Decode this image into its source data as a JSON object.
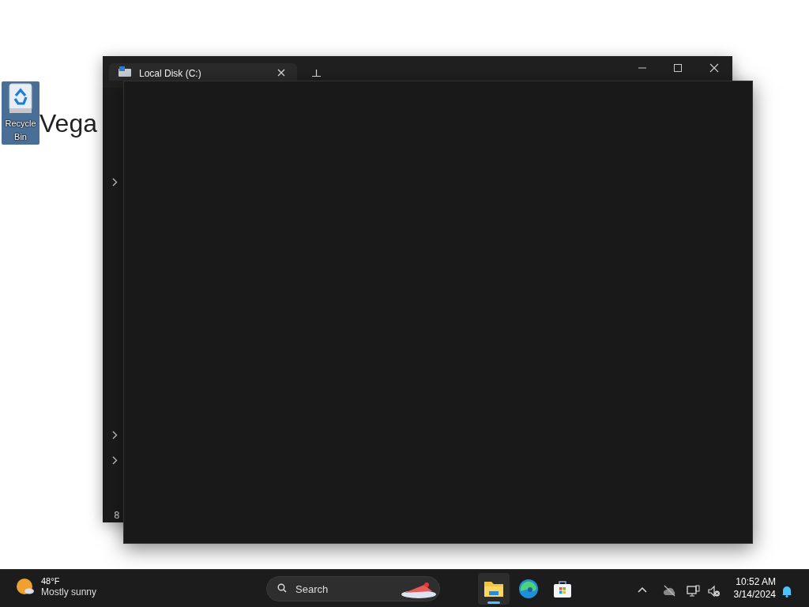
{
  "desktop": {
    "background_text": "Vega",
    "icons": [
      {
        "label": "Recycle Bin",
        "selected": true
      }
    ]
  },
  "explorer": {
    "tab": {
      "title": "Local Disk (C:)"
    },
    "status": "8"
  },
  "taskbar": {
    "weather": {
      "temp": "48°F",
      "condition": "Mostly sunny"
    },
    "search": {
      "placeholder": "Search"
    },
    "apps": [
      {
        "kind": "explorer",
        "active": true
      },
      {
        "kind": "edge",
        "active": false
      },
      {
        "kind": "store",
        "active": false
      }
    ],
    "clock": {
      "time": "10:52 AM",
      "date": "3/14/2024"
    }
  }
}
